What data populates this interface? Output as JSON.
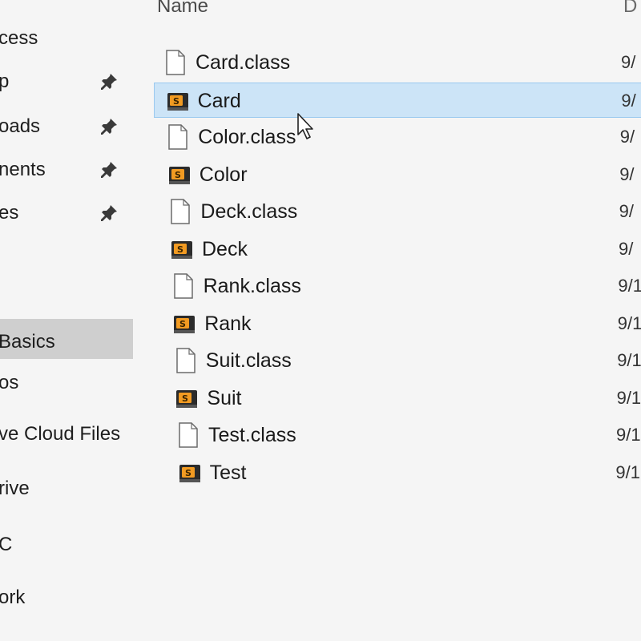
{
  "nav": {
    "items": [
      {
        "label": "cess",
        "pinned": false,
        "selected": false
      },
      {
        "label": "p",
        "pinned": true,
        "selected": false
      },
      {
        "label": "oads",
        "pinned": true,
        "selected": false
      },
      {
        "label": "nents",
        "pinned": true,
        "selected": false
      },
      {
        "label": "es",
        "pinned": true,
        "selected": false
      },
      {
        "label": "Basics",
        "pinned": false,
        "selected": true
      },
      {
        "label": "os",
        "pinned": false,
        "selected": false
      },
      {
        "label": "ve Cloud Files",
        "pinned": false,
        "selected": false
      },
      {
        "label": "rive",
        "pinned": false,
        "selected": false
      },
      {
        "label": "C",
        "pinned": false,
        "selected": false
      },
      {
        "label": "ork",
        "pinned": false,
        "selected": false
      }
    ],
    "pin_icon": "pin-icon"
  },
  "file_list": {
    "columns": {
      "name": "Name",
      "date": "D"
    },
    "selected_color": "#cce4f7",
    "files": [
      {
        "name": "Card.class",
        "icon": "blank-file-icon",
        "date": "9/"
      },
      {
        "name": "Card",
        "icon": "sublime-file-icon",
        "date": "9/",
        "selected": true
      },
      {
        "name": "Color.class",
        "icon": "blank-file-icon",
        "date": "9/"
      },
      {
        "name": "Color",
        "icon": "sublime-file-icon",
        "date": "9/"
      },
      {
        "name": "Deck.class",
        "icon": "blank-file-icon",
        "date": "9/"
      },
      {
        "name": "Deck",
        "icon": "sublime-file-icon",
        "date": "9/"
      },
      {
        "name": "Rank.class",
        "icon": "blank-file-icon",
        "date": "9/1"
      },
      {
        "name": "Rank",
        "icon": "sublime-file-icon",
        "date": "9/1"
      },
      {
        "name": "Suit.class",
        "icon": "blank-file-icon",
        "date": "9/1"
      },
      {
        "name": "Suit",
        "icon": "sublime-file-icon",
        "date": "9/1"
      },
      {
        "name": "Test.class",
        "icon": "blank-file-icon",
        "date": "9/1"
      },
      {
        "name": "Test",
        "icon": "sublime-file-icon",
        "date": "9/1"
      }
    ]
  },
  "cursor_icon": "mouse-pointer-icon"
}
